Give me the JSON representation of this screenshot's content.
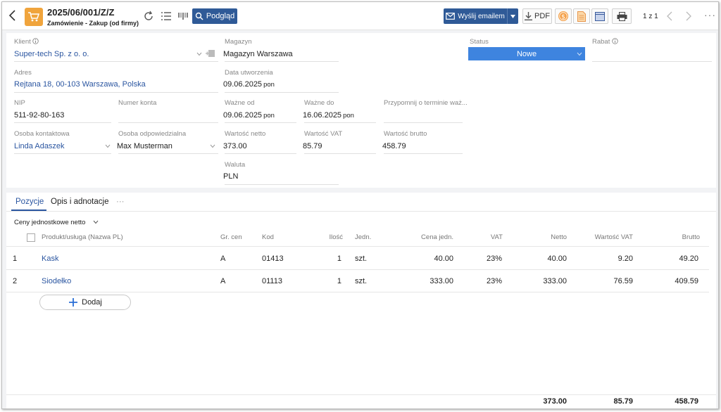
{
  "header": {
    "doc_number": "2025/06/001/Z/Z",
    "doc_type": "Zamówienie - Zakup (od firmy)",
    "preview_label": "Podgląd",
    "email_label": "Wyślij emailem",
    "pdf_label": "PDF",
    "pager": "1 z 1",
    "more": "···",
    "icons": [
      "back-icon",
      "cart-icon",
      "refresh-icon",
      "list-icon",
      "barcode-icon",
      "search-icon",
      "mail-icon",
      "download-icon",
      "dollar-icon",
      "document-icon",
      "table-icon",
      "print-icon",
      "chevron-left-icon",
      "chevron-right-icon"
    ]
  },
  "form": {
    "client_label": "Klient",
    "client_value": "Super-tech Sp. z o. o.",
    "address_label": "Adres",
    "address_value": "Rejtana 18, 00-103 Warszawa, Polska",
    "nip_label": "NIP",
    "nip_value": "511-92-80-163",
    "account_label": "Numer konta",
    "account_value": "",
    "contact_label": "Osoba kontaktowa",
    "contact_value": "Linda Adaszek",
    "responsible_label": "Osoba odpowiedzialna",
    "responsible_value": "Max Musterman",
    "warehouse_label": "Magazyn",
    "warehouse_value": "Magazyn Warszawa",
    "created_label": "Data utworzenia",
    "created_value": "09.06.2025",
    "created_day": "pon",
    "valid_from_label": "Ważne od",
    "valid_from_value": "09.06.2025",
    "valid_from_day": "pon",
    "valid_to_label": "Ważne do",
    "valid_to_value": "16.06.2025",
    "valid_to_day": "pon",
    "reminder_label": "Przypomnij o terminie waż...",
    "net_label": "Wartość netto",
    "net_value": "373.00",
    "vat_label": "Wartość VAT",
    "vat_value": "85.79",
    "gross_label": "Wartość brutto",
    "gross_value": "458.79",
    "currency_label": "Waluta",
    "currency_value": "PLN",
    "status_label": "Status",
    "status_value": "Nowe",
    "discount_label": "Rabat",
    "status_color": "#3e84df",
    "accent_color": "#2f5a97"
  },
  "tabs": [
    {
      "label": "Pozycje"
    },
    {
      "label": "Opis i adnotacje"
    },
    {
      "label": "···"
    }
  ],
  "table": {
    "price_mode": "Ceny jednostkowe netto",
    "headers": {
      "product": "Produkt/usługa (Nazwa PL)",
      "price_group": "Gr. cen",
      "code": "Kod",
      "qty": "Ilość",
      "unit": "Jedn.",
      "unit_price": "Cena jedn.",
      "vat": "VAT",
      "net": "Netto",
      "vat_value": "Wartość VAT",
      "gross": "Brutto"
    },
    "rows": [
      {
        "no": "1",
        "product": "Kask",
        "price_group": "A",
        "code": "01413",
        "qty": "1",
        "unit": "szt.",
        "unit_price": "40.00",
        "vat": "23%",
        "net": "40.00",
        "vat_value": "9.20",
        "gross": "49.20"
      },
      {
        "no": "2",
        "product": "Siodełko",
        "price_group": "A",
        "code": "01113",
        "qty": "1",
        "unit": "szt.",
        "unit_price": "333.00",
        "vat": "23%",
        "net": "333.00",
        "vat_value": "76.59",
        "gross": "409.59"
      }
    ],
    "add_label": "Dodaj",
    "totals": {
      "net": "373.00",
      "vat_value": "85.79",
      "gross": "458.79"
    }
  }
}
